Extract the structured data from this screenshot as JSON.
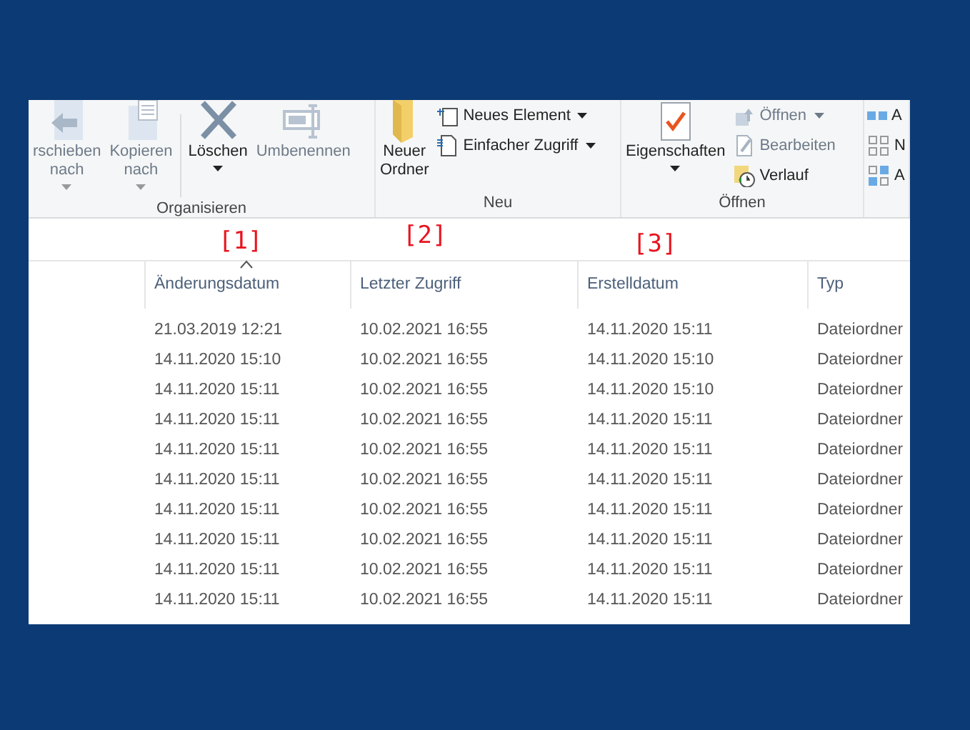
{
  "ribbon": {
    "groups": [
      {
        "label": "Organisieren",
        "buttons": [
          {
            "label": "rschieben nach",
            "kind": "move",
            "menu": true,
            "disabled": true
          },
          {
            "label": "Kopieren nach",
            "kind": "copy",
            "menu": true,
            "disabled": true
          },
          {
            "label": "Löschen",
            "kind": "delete",
            "menu": true,
            "disabled": false
          },
          {
            "label": "Umbenennen",
            "kind": "rename",
            "menu": false,
            "disabled": true
          }
        ]
      },
      {
        "label": "Neu",
        "buttons": [
          {
            "label": "Neuer Ordner",
            "kind": "folder",
            "menu": false,
            "disabled": false
          }
        ],
        "small": [
          {
            "label": "Neues Element",
            "kind": "newitem",
            "menu": true,
            "disabled": false
          },
          {
            "label": "Einfacher Zugriff",
            "kind": "easy",
            "menu": true,
            "disabled": false
          }
        ]
      },
      {
        "label": "Öffnen",
        "buttons": [
          {
            "label": "Eigenschaften",
            "kind": "props",
            "menu": true,
            "disabled": false
          }
        ],
        "small": [
          {
            "label": "Öffnen",
            "kind": "open",
            "menu": true,
            "disabled": true
          },
          {
            "label": "Bearbeiten",
            "kind": "edit",
            "menu": false,
            "disabled": true
          },
          {
            "label": "Verlauf",
            "kind": "history",
            "menu": false,
            "disabled": false
          }
        ]
      },
      {
        "small": [
          {
            "label": "A",
            "kind": "selall",
            "menu": false,
            "disabled": false
          },
          {
            "label": "N",
            "kind": "selnone",
            "menu": false,
            "disabled": false
          },
          {
            "label": "A",
            "kind": "invert",
            "menu": false,
            "disabled": false
          }
        ]
      }
    ]
  },
  "annotations": [
    "[1]",
    "[2]",
    "[3]"
  ],
  "table": {
    "columns": [
      {
        "label": "Änderungsdatum",
        "sorted": true
      },
      {
        "label": "Letzter Zugriff",
        "sorted": false
      },
      {
        "label": "Erstelldatum",
        "sorted": false
      },
      {
        "label": "Typ",
        "sorted": false
      }
    ],
    "rows": [
      [
        "21.03.2019 12:21",
        "10.02.2021 16:55",
        "14.11.2020 15:11",
        "Dateiordner"
      ],
      [
        "14.11.2020 15:10",
        "10.02.2021 16:55",
        "14.11.2020 15:10",
        "Dateiordner"
      ],
      [
        "14.11.2020 15:11",
        "10.02.2021 16:55",
        "14.11.2020 15:10",
        "Dateiordner"
      ],
      [
        "14.11.2020 15:11",
        "10.02.2021 16:55",
        "14.11.2020 15:11",
        "Dateiordner"
      ],
      [
        "14.11.2020 15:11",
        "10.02.2021 16:55",
        "14.11.2020 15:11",
        "Dateiordner"
      ],
      [
        "14.11.2020 15:11",
        "10.02.2021 16:55",
        "14.11.2020 15:11",
        "Dateiordner"
      ],
      [
        "14.11.2020 15:11",
        "10.02.2021 16:55",
        "14.11.2020 15:11",
        "Dateiordner"
      ],
      [
        "14.11.2020 15:11",
        "10.02.2021 16:55",
        "14.11.2020 15:11",
        "Dateiordner"
      ],
      [
        "14.11.2020 15:11",
        "10.02.2021 16:55",
        "14.11.2020 15:11",
        "Dateiordner"
      ],
      [
        "14.11.2020 15:11",
        "10.02.2021 16:55",
        "14.11.2020 15:11",
        "Dateiordner"
      ]
    ]
  }
}
